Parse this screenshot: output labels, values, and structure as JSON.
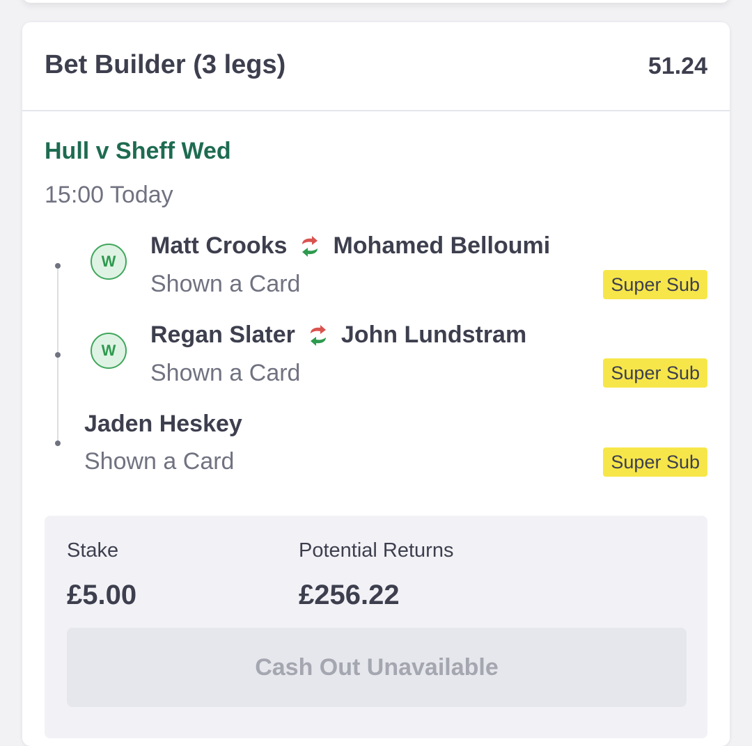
{
  "bet": {
    "title": "Bet Builder (3 legs)",
    "odds": "51.24"
  },
  "event": {
    "name": "Hull v Sheff Wed",
    "time": "15:00 Today"
  },
  "legs": [
    {
      "badge": "W",
      "player": "Matt Crooks",
      "substitute": "Mohamed Belloumi",
      "market": "Shown a Card",
      "tag": "Super Sub"
    },
    {
      "badge": "W",
      "player": "Regan Slater",
      "substitute": "John Lundstram",
      "market": "Shown a Card",
      "tag": "Super Sub"
    },
    {
      "player": "Jaden Heskey",
      "market": "Shown a Card",
      "tag": "Super Sub"
    }
  ],
  "stake": {
    "label": "Stake",
    "value": "£5.00"
  },
  "returns": {
    "label": "Potential Returns",
    "value": "£256.22"
  },
  "cashout": {
    "label": "Cash Out Unavailable"
  },
  "colors": {
    "event_green": "#1e6b52",
    "win_badge": "#3fa65b",
    "super_sub_yellow": "#f7e64a",
    "swap_red": "#d9534f",
    "swap_green": "#2e9a4f"
  },
  "icons": {
    "win": "check-w-badge",
    "substitution": "swap-arrows-icon"
  }
}
